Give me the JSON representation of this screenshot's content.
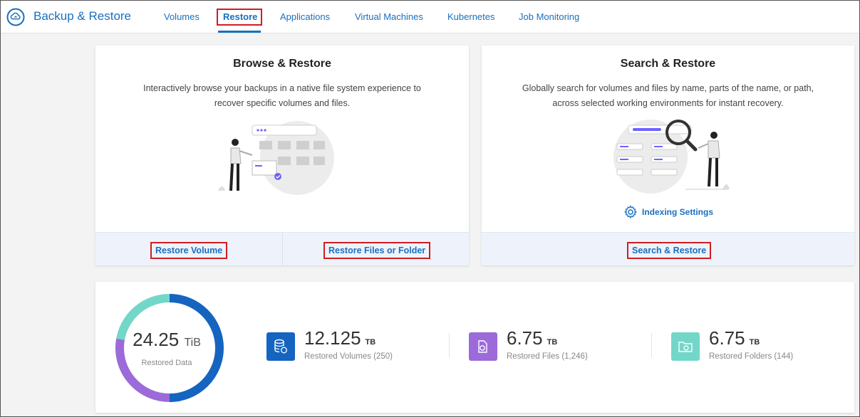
{
  "app": {
    "title": "Backup & Restore"
  },
  "nav": {
    "tabs": [
      {
        "label": "Volumes"
      },
      {
        "label": "Restore"
      },
      {
        "label": "Applications"
      },
      {
        "label": "Virtual Machines"
      },
      {
        "label": "Kubernetes"
      },
      {
        "label": "Job Monitoring"
      }
    ],
    "active_tab": "Restore"
  },
  "browse_card": {
    "title": "Browse & Restore",
    "description": "Interactively browse your backups in a native file system experience to recover specific volumes and files.",
    "restore_volume_label": "Restore Volume",
    "restore_files_label": "Restore Files or Folder"
  },
  "search_card": {
    "title": "Search & Restore",
    "description": "Globally search for volumes and files by name, parts of the name, or path, across selected working environments for instant recovery.",
    "indexing_label": "Indexing Settings",
    "search_restore_label": "Search & Restore"
  },
  "stats": {
    "total": {
      "value": "24.25",
      "unit": "TiB",
      "label": "Restored Data"
    },
    "volumes": {
      "value": "12.125",
      "unit": "TB",
      "label": "Restored Volumes (250)"
    },
    "files": {
      "value": "6.75",
      "unit": "TB",
      "label": "Restored Files (1,246)"
    },
    "folders": {
      "value": "6.75",
      "unit": "TB",
      "label": "Restored Folders (144)"
    }
  },
  "colors": {
    "accent": "#1a6fbf",
    "highlight_box": "#d21c24",
    "volumes": "#1565c0",
    "files": "#9c6ad9",
    "folders": "#72d7c8"
  },
  "donut_shares": {
    "volumes": 0.5,
    "files": 0.278,
    "folders": 0.222
  }
}
